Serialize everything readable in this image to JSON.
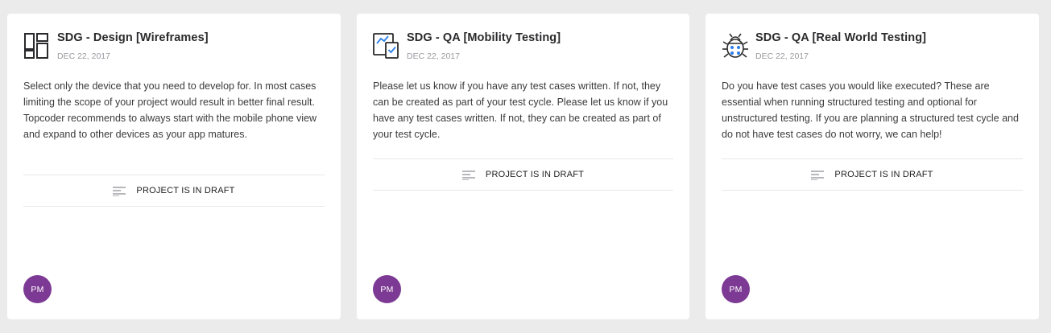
{
  "cards": [
    {
      "title": "SDG - Design [Wireframes]",
      "date": "DEC 22, 2017",
      "description": "Select only the device that you need to develop for. In most cases limiting the scope of your project would result in better final result. Topcoder recommends to always start with the mobile phone view and expand to other devices as your app matures.",
      "status": "PROJECT IS IN DRAFT",
      "avatar": "PM",
      "icon": "wireframes-icon"
    },
    {
      "title": "SDG - QA [Mobility Testing]",
      "date": "DEC 22, 2017",
      "description": "Please let us know if you have any test cases written. If not, they can be created as part of your test cycle. Please let us know if you have any test cases written. If not, they can be created as part of your test cycle.",
      "status": "PROJECT IS IN DRAFT",
      "avatar": "PM",
      "icon": "mobility-testing-icon"
    },
    {
      "title": "SDG - QA [Real World Testing]",
      "date": "DEC 22, 2017",
      "description": "Do you have test cases you would like executed? These are essential when running structured testing and optional for unstructured testing. If you are planning a structured test cycle and do not have test cases do not worry, we can help!",
      "status": "PROJECT IS IN DRAFT",
      "avatar": "PM",
      "icon": "bug-icon"
    }
  ],
  "colors": {
    "background": "#ebebeb",
    "card": "#ffffff",
    "avatar": "#7d3a94",
    "icon_dark": "#2a2a2c",
    "icon_accent": "#2b7de9"
  }
}
